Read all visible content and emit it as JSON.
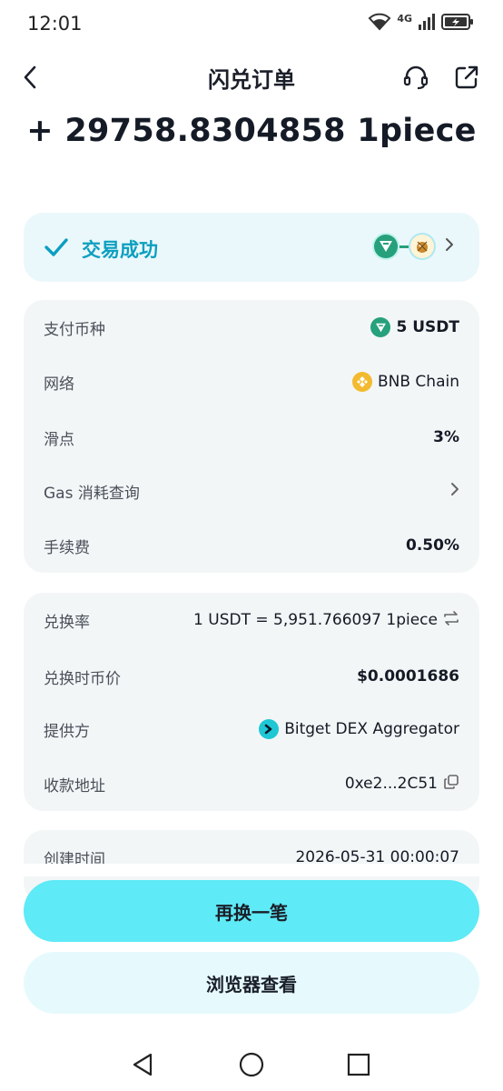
{
  "status_bar": {
    "time": "12:01",
    "network": "4G"
  },
  "nav": {
    "title": "闪兑订单"
  },
  "amount": "+ 29758.8304858 1piece",
  "trade_status": {
    "text": "交易成功"
  },
  "details_card1": {
    "rows": [
      {
        "label": "支付币种",
        "value": "5 USDT",
        "icon": "usdt-icon"
      },
      {
        "label": "网络",
        "value": "BNB Chain",
        "icon": "bnb-icon"
      },
      {
        "label": "滑点",
        "value": "3%"
      },
      {
        "label": "Gas 消耗查询",
        "value": "",
        "icon": "chevron-right-icon"
      },
      {
        "label": "手续费",
        "value": "0.50%"
      }
    ]
  },
  "details_card2": {
    "rows": [
      {
        "label": "兑换率",
        "value": "1 USDT = 5,951.766097 1piece",
        "icon": "swap-icon"
      },
      {
        "label": "兑换时币价",
        "value": "$0.0001686"
      },
      {
        "label": "提供方",
        "value": "Bitget DEX Aggregator",
        "icon": "bitget-icon"
      },
      {
        "label": "收款地址",
        "value": "0xe2...2C51",
        "icon": "copy-icon"
      }
    ]
  },
  "details_card3": {
    "rows": [
      {
        "label": "创建时间",
        "value": "2026-05-31 00:00:07"
      }
    ]
  },
  "buttons": {
    "again": "再换一笔",
    "explorer": "浏览器查看"
  },
  "colors": {
    "accent": "#5eeaf6",
    "success": "#0b9fc0",
    "usdt": "#26a17b",
    "bnb": "#f3ba2f"
  }
}
